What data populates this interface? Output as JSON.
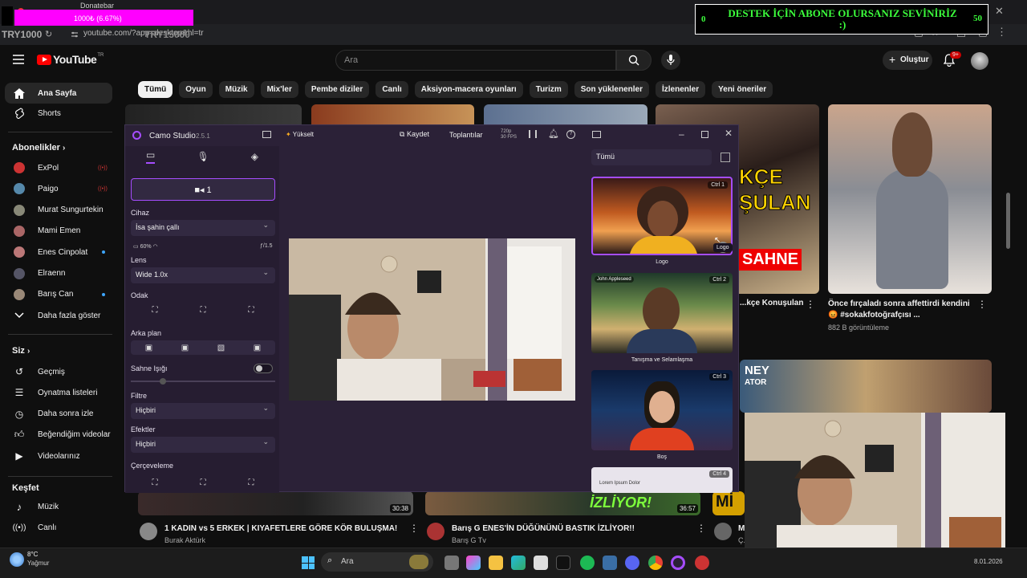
{
  "overlay": {
    "donate_label": "Donatebar",
    "donate_progress": "1000₺ (6.67%)",
    "try_left": "TRY1000",
    "try_right": "TRY15000",
    "goal_left": "0",
    "goal_text": "DESTEK İÇİN ABONE OLURSANIZ SEVİNİRİZ :)",
    "goal_right": "50"
  },
  "browser": {
    "url": "youtube.com/?app=desktop&hl=tr"
  },
  "youtube": {
    "logo": "YouTube",
    "logo_suffix": "TR",
    "search_placeholder": "Ara",
    "create_label": "Oluştur",
    "notif_count": "9+",
    "chips": [
      "Tümü",
      "Oyun",
      "Müzik",
      "Mix'ler",
      "Pembe diziler",
      "Canlı",
      "Aksiyon-macera oyunları",
      "Turizm",
      "Son yüklenenler",
      "İzlenenler",
      "Yeni öneriler"
    ],
    "sidebar": {
      "home": "Ana Sayfa",
      "shorts": "Shorts",
      "subs_header": "Abonelikler",
      "subs": [
        "ExPol",
        "Paigo",
        "Murat Sungurtekin",
        "Mami Emen",
        "Enes Cinpolat",
        "Elraenn",
        "Barış Can"
      ],
      "show_more": "Daha fazla göster",
      "you_header": "Siz",
      "you_items": [
        "Geçmiş",
        "Oynatma listeleri",
        "Daha sonra izle",
        "Beğendiğim videolar",
        "Videolarınız"
      ],
      "explore_header": "Keşfet",
      "explore_items": [
        "Müzik",
        "Canlı"
      ]
    },
    "right_videos": [
      {
        "title": "...kçe Konuşulan",
        "thumb_text": [
          "KÇE",
          "ŞULAN",
          "SAHNE"
        ]
      },
      {
        "title": "Önce fırçaladı sonra affettirdi kendini 😡 #sokakfotoğrafçısı ...",
        "stats": "882 B görüntüleme"
      }
    ],
    "right_thumb3_text": [
      "NEY",
      "ATOR"
    ],
    "bottom_videos": [
      {
        "title": "1 KADIN vs 5 ERKEK | KIYAFETLERE GÖRE KÖR BULUŞMA!",
        "channel": "Burak Aktürk",
        "duration": "30:38"
      },
      {
        "title": "Barış G ENES'İN DÜĞÜNÜNÜ BASTIK İZLİYOR!!",
        "channel": "Barış G Tv",
        "duration": "36:57",
        "thumb_text": "İZLİYOR!"
      },
      {
        "title": "M...",
        "channel": "Ç...",
        "thumb_text": "Mİ"
      }
    ]
  },
  "camo": {
    "app_name": "Camo Studio",
    "version": "2.5.1",
    "upgrade": "Yükselt",
    "record": "Kaydet",
    "meetings": "Toplantılar",
    "res": "720p",
    "fps": "30 FPS",
    "camera_chip": "1",
    "device_label": "Cihaz",
    "device_value": "İsa şahin çallı",
    "battery": "60%",
    "aperture": "ƒ/1.5",
    "lens_label": "Lens",
    "lens_value": "Wide 1.0x",
    "focus_label": "Odak",
    "bg_label": "Arka plan",
    "scene_light_label": "Sahne Işığı",
    "filter_label": "Filtre",
    "filter_value": "Hiçbiri",
    "effects_label": "Efektler",
    "effects_value": "Hiçbiri",
    "framing_label": "Çerçeveleme",
    "scenes_filter": "Tümü",
    "scenes": [
      {
        "ctrl": "Ctrl",
        "num": "1",
        "label": "Logo"
      },
      {
        "ctrl": "Ctrl",
        "num": "2",
        "label": "Tanışma ve Selamlaşma",
        "badge": "John Appleseed"
      },
      {
        "ctrl": "Ctrl",
        "num": "3",
        "label": "Boş"
      },
      {
        "ctrl": "Ctrl",
        "num": "4",
        "label": "",
        "inner": "Lorem Ipsum Dolor"
      }
    ],
    "tooltip": "Logo"
  },
  "taskbar": {
    "temp": "8°C",
    "weather": "Yağmur",
    "search": "Ara",
    "date": "8.01.2026"
  },
  "colors": {
    "yt_red": "#ff0000",
    "camo_bg": "#2b2137",
    "accent_purple": "#a64dff",
    "goal_green": "#3cff3c"
  }
}
